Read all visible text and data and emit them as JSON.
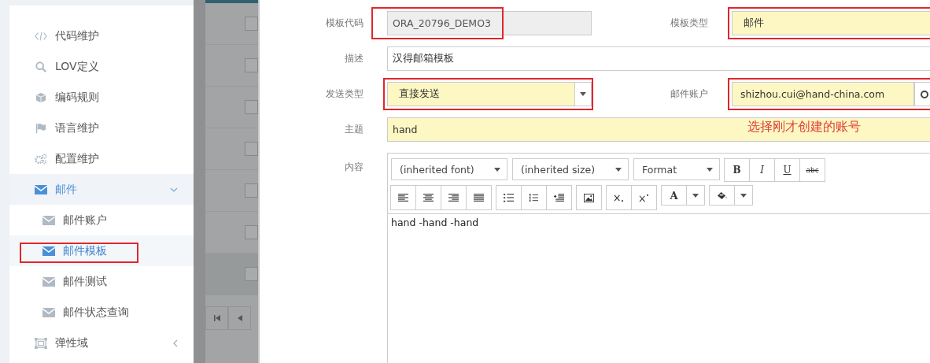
{
  "sidebar": {
    "items": [
      {
        "kind": "code",
        "label": "代码维护",
        "selected": false
      },
      {
        "kind": "search",
        "label": "LOV定义",
        "selected": false
      },
      {
        "kind": "cube",
        "label": "编码规则",
        "selected": false
      },
      {
        "kind": "flag",
        "label": "语言维护",
        "selected": false
      },
      {
        "kind": "gears",
        "label": "配置维护",
        "selected": false
      },
      {
        "kind": "mail",
        "label": "邮件",
        "selected": false,
        "expanded": true,
        "children": [
          {
            "kind": "mail",
            "label": "邮件账户",
            "selected": false,
            "highlighted": false
          },
          {
            "kind": "mail",
            "label": "邮件模板",
            "selected": true,
            "highlighted": true
          },
          {
            "kind": "mail",
            "label": "邮件测试",
            "selected": false,
            "highlighted": false
          },
          {
            "kind": "mail",
            "label": "邮件状态查询",
            "selected": false,
            "highlighted": false
          }
        ]
      },
      {
        "kind": "frame",
        "label": "弹性域",
        "selected": false,
        "expanded": false
      }
    ]
  },
  "background_table": {
    "rows": [
      {
        "checked": false
      },
      {
        "checked": false
      },
      {
        "checked": false
      },
      {
        "checked": false
      },
      {
        "checked": false
      },
      {
        "checked": false
      },
      {
        "checked": false
      }
    ]
  },
  "form": {
    "rows": [
      {
        "fields": [
          {
            "kind": "text",
            "label": "模板代码",
            "value": "ORA_20796_DEMO3",
            "required": false,
            "disabled": true,
            "highlighted": true
          },
          {
            "kind": "select",
            "label": "模板类型",
            "value": "邮件",
            "required": true,
            "highlighted": true
          }
        ]
      },
      {
        "fields": [
          {
            "kind": "text",
            "label": "描述",
            "value": "汉得邮箱模板",
            "required": false,
            "disabled": false,
            "highlighted": false
          }
        ]
      },
      {
        "fields": [
          {
            "kind": "select",
            "label": "发送类型",
            "value": "直接发送",
            "required": true,
            "highlighted": true
          },
          {
            "kind": "lookup",
            "label": "邮件账户",
            "value": "shizhou.cui@hand-china.com",
            "required": true,
            "highlighted": true
          }
        ]
      },
      {
        "fields": [
          {
            "kind": "text",
            "label": "主题",
            "value": "hand",
            "required": true,
            "disabled": false,
            "highlighted": false
          }
        ]
      }
    ],
    "annotation": "选择刚才创建的账号"
  },
  "editor": {
    "label": "内容",
    "selects": [
      "(inherited font)",
      "(inherited size)",
      "Format"
    ],
    "styles": [
      "B",
      "I",
      "U",
      "abc"
    ],
    "color_button": "A",
    "text": "hand -hand -hand"
  }
}
